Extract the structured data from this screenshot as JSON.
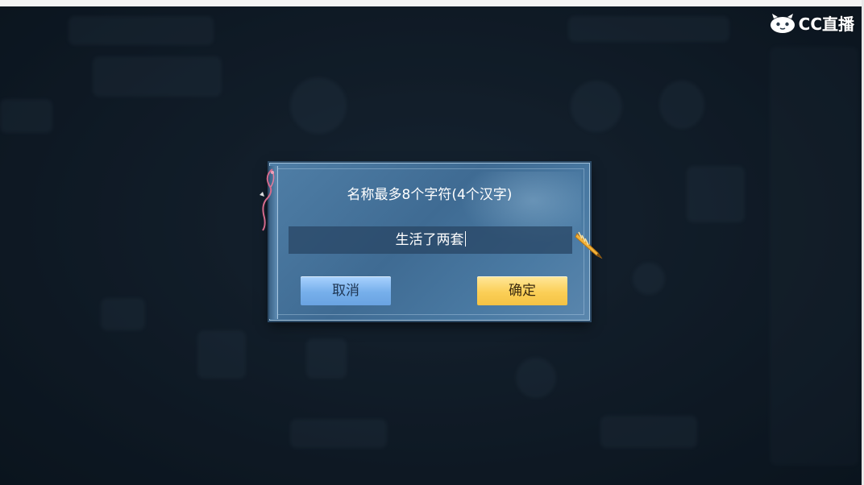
{
  "watermark": {
    "brand": "CC直播",
    "icon": "cc-live-mascot-icon"
  },
  "dialog": {
    "title": "名称最多8个字符(4个汉字)",
    "input_value": "生活了两套",
    "cancel_label": "取消",
    "confirm_label": "确定",
    "pen_icon": "quill-pen-icon"
  },
  "colors": {
    "dialog_bg": "#4a78a0",
    "cancel_button": "#7ab3ee",
    "confirm_button": "#fbd05a",
    "backdrop": "#15222f"
  }
}
